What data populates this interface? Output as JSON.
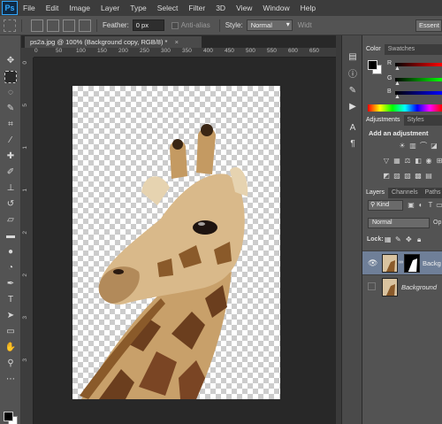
{
  "app": {
    "logo": "Ps"
  },
  "menu": [
    "File",
    "Edit",
    "Image",
    "Layer",
    "Type",
    "Select",
    "Filter",
    "3D",
    "View",
    "Window",
    "Help"
  ],
  "options_bar": {
    "feather_label": "Feather:",
    "feather_value": "0 px",
    "antialias_label": "Anti-alias",
    "style_label": "Style:",
    "style_value": "Normal",
    "width_label": "Widt",
    "workspace": "Essent"
  },
  "document": {
    "tab_title": "ps2a.jpg @ 100% (Background copy, RGB/8) *",
    "close": "×"
  },
  "rulers": {
    "top": [
      "0",
      "50",
      "100",
      "150",
      "200",
      "250",
      "300",
      "350",
      "400",
      "450",
      "500",
      "550",
      "600",
      "650"
    ],
    "left": [
      "0",
      "5",
      "1",
      "1",
      "2",
      "2",
      "3",
      "3"
    ]
  },
  "panels": {
    "color_tabs": [
      "Color",
      "Swatches"
    ],
    "sliders": [
      {
        "label": "R",
        "gradient_end": "#ff0000"
      },
      {
        "label": "G",
        "gradient_end": "#00ff00"
      },
      {
        "label": "B",
        "gradient_end": "#0000ff"
      }
    ],
    "adjust_tabs": [
      "Adjustments",
      "Styles"
    ],
    "adjust_title": "Add an adjustment",
    "layers_tabs": [
      "Layers",
      "Channels",
      "Paths"
    ],
    "kind": "Kind",
    "blend_mode": "Normal",
    "opacity_label": "Op",
    "lock_label": "Lock:",
    "layers": [
      {
        "name": "Background copy",
        "name_short": "Backg",
        "selected": true,
        "visible": true
      },
      {
        "name": "Background",
        "selected": false,
        "visible": false
      }
    ]
  },
  "colors": {
    "foreground": "#000000",
    "background": "#ffffff",
    "selected_layer": "#6f7f98"
  }
}
